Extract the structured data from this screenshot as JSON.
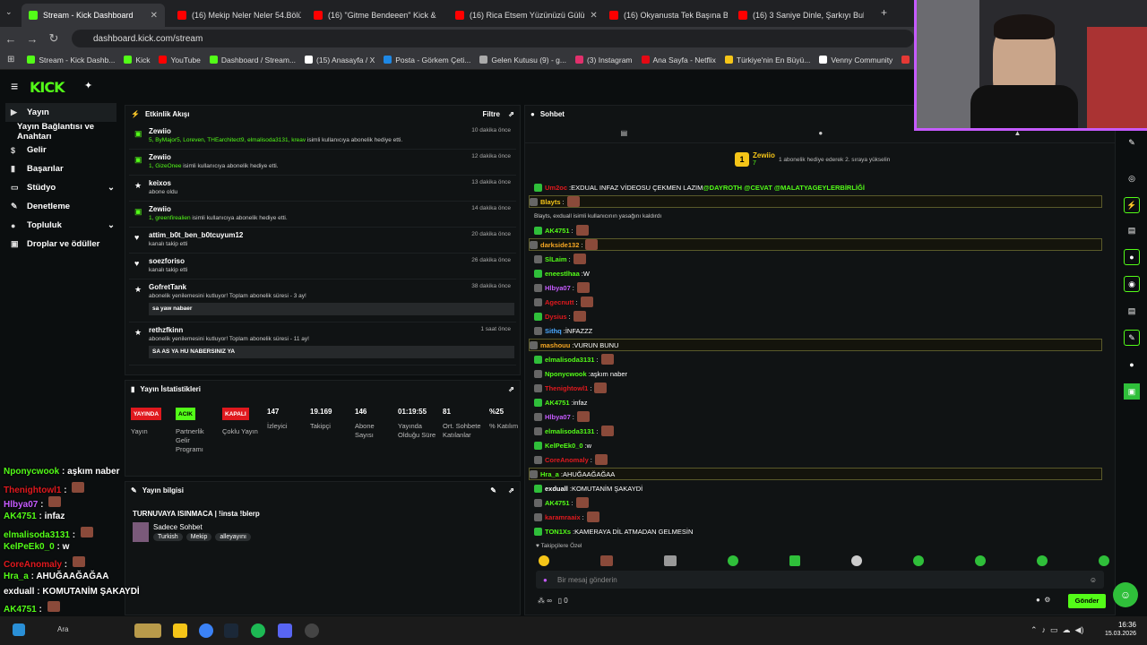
{
  "tabs": [
    {
      "label": "Stream - Kick Dashboard",
      "color": "#53fc18"
    },
    {
      "label": "(16) Mekip Neler Neler 54.Bölü",
      "color": "#ff0000"
    },
    {
      "label": "(16) \"Gitme Bendeeen\" Kick &",
      "color": "#ff0000"
    },
    {
      "label": "(16) Rica Etsem Yüzünüzü Gülü",
      "color": "#ff0000"
    },
    {
      "label": "(16) Okyanusta Tek Başına Bulu",
      "color": "#ff0000"
    },
    {
      "label": "(16) 3 Saniye Dinle, Şarkıyı Bul!",
      "color": "#ff0000"
    }
  ],
  "url": "dashboard.kick.com/stream",
  "bookmarks": [
    {
      "label": "Stream - Kick Dashb...",
      "color": "#53fc18"
    },
    {
      "label": "Kick",
      "color": "#53fc18"
    },
    {
      "label": "YouTube",
      "color": "#ff0000"
    },
    {
      "label": "Dashboard / Stream...",
      "color": "#53fc18"
    },
    {
      "label": "(15) Anasayfa / X",
      "color": "#ffffff"
    },
    {
      "label": "Posta - Görkem Çeti...",
      "color": "#1e88e5"
    },
    {
      "label": "Gelen Kutusu (9) - g...",
      "color": "#aaaaaa"
    },
    {
      "label": "(3) Instagram",
      "color": "#e1306c"
    },
    {
      "label": "Ana Sayfa - Netflix",
      "color": "#e50914"
    },
    {
      "label": "Türkiye'nin En Büyü...",
      "color": "#f5c518"
    },
    {
      "label": "Venny Community",
      "color": "#ffffff"
    },
    {
      "label": "Lifein",
      "color": "#e53935"
    }
  ],
  "logo": "KICK",
  "sidebar": [
    {
      "label": "Yayın",
      "icon": "▶"
    },
    {
      "label": "Yayın Bağlantısı ve Anahtarı",
      "icon": ""
    },
    {
      "label": "Gelir",
      "icon": "$"
    },
    {
      "label": "Başarılar",
      "icon": "▮"
    },
    {
      "label": "Stüdyo",
      "icon": "▭"
    },
    {
      "label": "Denetleme",
      "icon": "✎"
    },
    {
      "label": "Topluluk",
      "icon": "●"
    },
    {
      "label": "Droplar ve ödüller",
      "icon": "▣"
    }
  ],
  "activity": {
    "title": "Etkinlik Akışı",
    "filter": "Filtre",
    "events": [
      {
        "name": "Zewiio",
        "desc_g": "5, ByMajor5, Loreven, THEarchitect9, elmalisoda3131, kreav",
        "desc": " isimli kullanıcıya abonelik hediye etti.",
        "time": "10 dakika önce",
        "icon": "gift"
      },
      {
        "name": "Zewiio",
        "desc_g": "1, GizeOnee",
        "desc": " isimli kullanıcıya abonelik hediye etti.",
        "time": "12 dakika önce",
        "icon": "gift"
      },
      {
        "name": "keixos",
        "desc_g": "",
        "desc": "abone oldu",
        "time": "13 dakika önce",
        "icon": "star"
      },
      {
        "name": "Zewiio",
        "desc_g": "1, greenfirealien",
        "desc": " isimli kullanıcıya abonelik hediye etti.",
        "time": "14 dakika önce",
        "icon": "gift"
      },
      {
        "name": "attim_b0t_ben_b0tcuyum12",
        "desc_g": "",
        "desc": "kanalı takip etti",
        "time": "20 dakika önce",
        "icon": "heart"
      },
      {
        "name": "soezforiso",
        "desc_g": "",
        "desc": "kanalı takip etti",
        "time": "26 dakika önce",
        "icon": "heart"
      },
      {
        "name": "GofretTank",
        "desc_g": "",
        "desc": "abonelik yenilemesini kutluyor! Toplam abonelik süresi - 3 ay!",
        "time": "38 dakika önce",
        "icon": "star",
        "msg": "sa yaw nabaer"
      },
      {
        "name": "rethzfkinn",
        "desc_g": "",
        "desc": "abonelik yenilemesini kutluyor! Toplam abonelik süresi - 11 ay!",
        "time": "1 saat önce",
        "icon": "star",
        "msg": "SA AS YA HU NABERSINIZ YA"
      }
    ]
  },
  "stats": {
    "title": "Yayın İstatistikleri",
    "badges": [
      {
        "label": "YAYINDA",
        "color": "#e0191e",
        "cap": "Yayın"
      },
      {
        "label": "ACIK",
        "color": "#53fc18",
        "cap": "Partnerlik Gelir Programı"
      },
      {
        "label": "KAPALI",
        "color": "#e0191e",
        "cap": "Çoklu Yayın"
      }
    ],
    "nums": [
      {
        "v": "147",
        "c": "İzleyici"
      },
      {
        "v": "19.169",
        "c": "Takipçi"
      },
      {
        "v": "146",
        "c": "Abone Sayısı"
      },
      {
        "v": "01:19:55",
        "c": "Yayında Olduğu Süre"
      },
      {
        "v": "81",
        "c": "Ort. Sohbete Katılanlar"
      },
      {
        "v": "%25",
        "c": "% Katılım"
      }
    ]
  },
  "info": {
    "title": "Yayın bilgisi",
    "stream_title": "TURNUVAYA ISINMACA | !insta !blerp",
    "category": "Sadece Sohbet",
    "tags": [
      "Turkish",
      "Mekip",
      "alleyayını"
    ]
  },
  "chat": {
    "title": "Sohbet",
    "pinned_user": "Zewiio",
    "pinned_count": "7",
    "pinned_text": "1 abonelik hediye ederek 2. sıraya yükselin",
    "placeholder": "Bir mesaj gönderin",
    "send": "Gönder",
    "followers_only": "Takipçilere Özel",
    "count": "0",
    "messages": [
      {
        "u": "Um2oc",
        "c": "#e0191e",
        "t": "EXDUAL INFAZ VİDEOSU ÇEKMEN LAZIM ",
        "m": "@DAYROTH @CEVAT @MALATYAGEYLERBİRLİĞİ"
      },
      {
        "u": "Blayts",
        "c": "#f5c518",
        "t": "",
        "e": 1,
        "hl": 1
      },
      {
        "u": "",
        "c": "#ddd",
        "t": "Blayts, exduall isimli kullanıcının yasağını kaldırdı",
        "sys": 1
      },
      {
        "u": "AK4751",
        "c": "#53fc18",
        "t": "",
        "e": 1
      },
      {
        "u": "darkside132",
        "c": "#f5a623",
        "t": "",
        "e": 1,
        "hl": 1
      },
      {
        "u": "SlLaim",
        "c": "#53fc18",
        "t": "",
        "e": 1
      },
      {
        "u": "eneestlhaa",
        "c": "#53fc18",
        "t": "W"
      },
      {
        "u": "Hlbya07",
        "c": "#c65bff",
        "t": "",
        "e": 1
      },
      {
        "u": "Agecnutt",
        "c": "#e0191e",
        "t": "",
        "e": 1
      },
      {
        "u": "Dysius",
        "c": "#e0191e",
        "t": "",
        "e": 1
      },
      {
        "u": "Sithq",
        "c": "#4aa8ff",
        "t": "İNFAZZZ"
      },
      {
        "u": "mashouu",
        "c": "#f5a623",
        "t": "VURUN BUNU",
        "hl": 1
      },
      {
        "u": "elmalisoda3131",
        "c": "#53fc18",
        "t": "",
        "e": 1
      },
      {
        "u": "Nponycwook",
        "c": "#53fc18",
        "t": "aşkım naber"
      },
      {
        "u": "Thenightowl1",
        "c": "#e0191e",
        "t": "",
        "e": 1
      },
      {
        "u": "AK4751",
        "c": "#53fc18",
        "t": "infaz"
      },
      {
        "u": "Hlbya07",
        "c": "#c65bff",
        "t": "",
        "e": 1
      },
      {
        "u": "elmalisoda3131",
        "c": "#53fc18",
        "t": "",
        "e": 1
      },
      {
        "u": "KelPeEk0_0",
        "c": "#53fc18",
        "t": "w"
      },
      {
        "u": "CoreAnomaly",
        "c": "#e0191e",
        "t": "",
        "e": 1
      },
      {
        "u": "Hra_a",
        "c": "#53fc18",
        "t": "AHUĞAAĞAĞAA",
        "hl": 1
      },
      {
        "u": "exduall",
        "c": "#fff",
        "t": "KOMUTANİM ŞAKAYDİ"
      },
      {
        "u": "AK4751",
        "c": "#53fc18",
        "t": "",
        "e": 1
      },
      {
        "u": "karamraaix",
        "c": "#e0191e",
        "t": "",
        "e": 1
      },
      {
        "u": "TON1Xs",
        "c": "#53fc18",
        "t": "KAMERAYA DİL ATMADAN GELMESİN"
      }
    ]
  },
  "overlay": [
    {
      "u": "Nponycwook",
      "c": "#53fc18",
      "t": "aşkım naber"
    },
    {
      "u": "Thenightowl1",
      "c": "#e0191e",
      "t": ""
    },
    {
      "u": "Hlbya07",
      "c": "#c65bff",
      "t": ""
    },
    {
      "u": "AK4751",
      "c": "#53fc18",
      "t": "infaz"
    },
    {
      "u": "elmalisoda3131",
      "c": "#53fc18",
      "t": ""
    },
    {
      "u": "KelPeEk0_0",
      "c": "#53fc18",
      "t": "w"
    },
    {
      "u": "CoreAnomaly",
      "c": "#e0191e",
      "t": ""
    },
    {
      "u": "Hra_a",
      "c": "#53fc18",
      "t": "AHUĞAAĞAĞAA"
    },
    {
      "u": "exduall",
      "c": "#fff",
      "t": "KOMUTANİM ŞAKAYDİ"
    },
    {
      "u": "AK4751",
      "c": "#53fc18",
      "t": ""
    },
    {
      "u": "karamraaix",
      "c": "#e0191e",
      "t": ""
    },
    {
      "u": "",
      "c": "#fff",
      "t": "AYA DİL ATMADAN GELMESIN"
    }
  ],
  "taskbar": {
    "time": "16:36",
    "date": "15.03.2026",
    "search": "Ara"
  }
}
